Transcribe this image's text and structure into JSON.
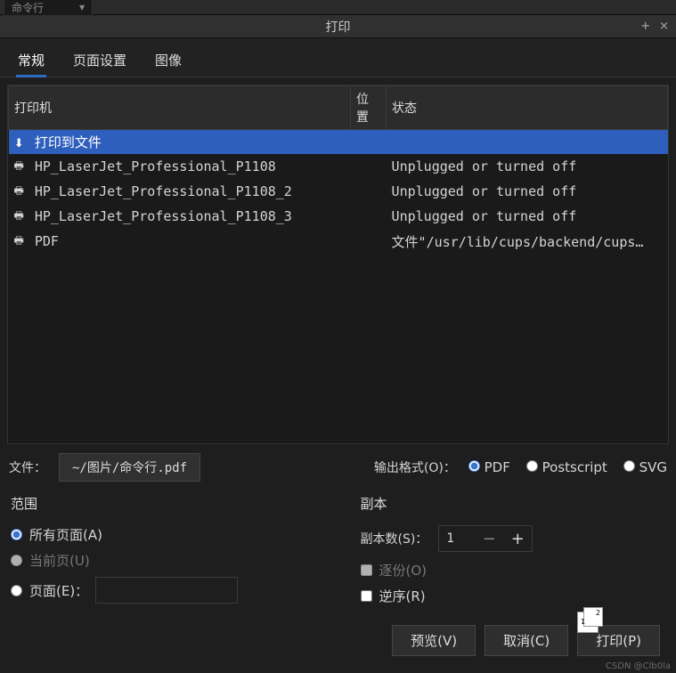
{
  "topbar": {
    "dropdown": "命令行"
  },
  "window": {
    "title": "打印",
    "minimize": "+",
    "close": "×"
  },
  "tabs": [
    {
      "label": "常规",
      "active": true
    },
    {
      "label": "页面设置",
      "active": false
    },
    {
      "label": "图像",
      "active": false
    }
  ],
  "printer_table": {
    "headers": {
      "printer": "打印机",
      "location": "位置",
      "status": "状态"
    },
    "rows": [
      {
        "icon": "download",
        "name": "打印到文件",
        "location": "",
        "status": "",
        "selected": true
      },
      {
        "icon": "printer",
        "name": "HP_LaserJet_Professional_P1108",
        "location": "",
        "status": "Unplugged or turned off",
        "selected": false
      },
      {
        "icon": "printer",
        "name": "HP_LaserJet_Professional_P1108_2",
        "location": "",
        "status": "Unplugged or turned off",
        "selected": false
      },
      {
        "icon": "printer",
        "name": "HP_LaserJet_Professional_P1108_3",
        "location": "",
        "status": "Unplugged or turned off",
        "selected": false
      },
      {
        "icon": "printer",
        "name": "PDF",
        "location": "",
        "status": "文件\"/usr/lib/cups/backend/cups…",
        "selected": false
      }
    ]
  },
  "file": {
    "label": "文件：",
    "path": "~/图片/命令行.pdf"
  },
  "output_format": {
    "label": "输出格式(O)：",
    "options": {
      "pdf": "PDF",
      "postscript": "Postscript",
      "svg": "SVG"
    },
    "selected": "pdf"
  },
  "range": {
    "title": "范围",
    "all_pages": "所有页面(A)",
    "current_page": "当前页(U)",
    "pages": "页面(E)："
  },
  "copies": {
    "title": "副本",
    "count_label": "副本数(S)：",
    "count_value": "1",
    "collate": "逐份(O)",
    "reverse": "逆序(R)"
  },
  "buttons": {
    "preview": "预览(V)",
    "cancel": "取消(C)",
    "print": "打印(P)"
  },
  "watermark": "CSDN @Clb0la"
}
